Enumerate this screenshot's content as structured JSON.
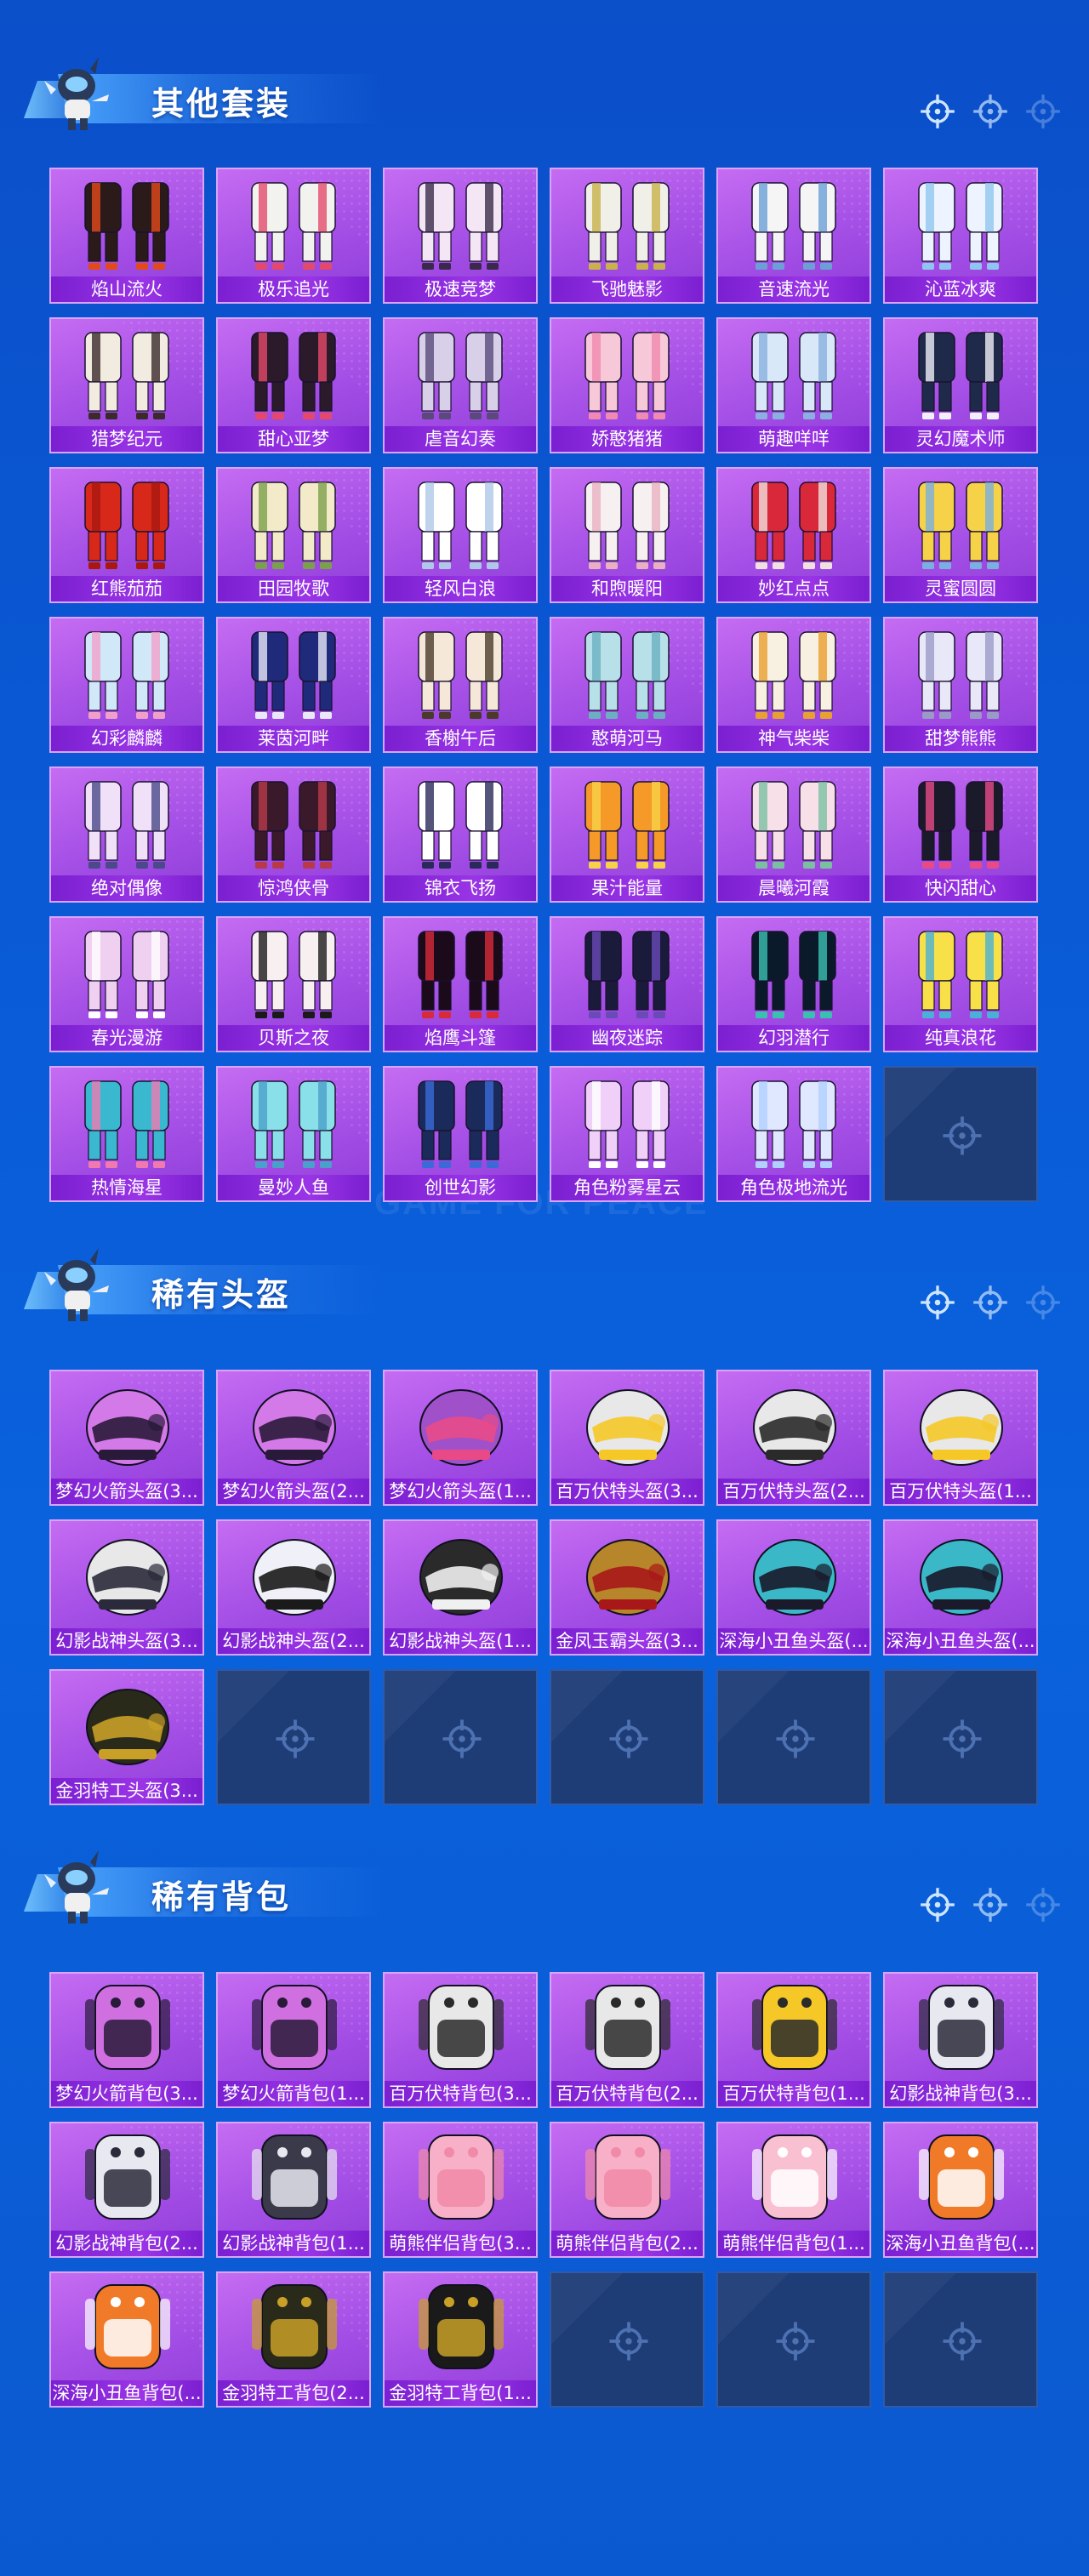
{
  "colors": {
    "background": "#0a58d4",
    "tile_purple": "#a44fe6",
    "label_bar": "#7a1fd1",
    "empty_tile": "#1e3d77"
  },
  "watermark": "GAME FOR PEACE",
  "sections": [
    {
      "title": "其他套装",
      "item_kind": "outfit",
      "items": [
        "焰山流火",
        "极乐追光",
        "极速竞梦",
        "飞驰魅影",
        "音速流光",
        "沁蓝冰爽",
        "猎梦纪元",
        "甜心亚梦",
        "虐音幻奏",
        "娇憨猪猪",
        "萌趣咩咩",
        "灵幻魔术师",
        "红熊茄茄",
        "田园牧歌",
        "轻风白浪",
        "和煦暖阳",
        "妙红点点",
        "灵蜜圆圆",
        "幻彩麟麟",
        "莱茵河畔",
        "香榭午后",
        "憨萌河马",
        "神气柴柴",
        "甜梦熊熊",
        "绝对偶像",
        "惊鸿侠骨",
        "锦衣飞扬",
        "果汁能量",
        "晨曦河霞",
        "快闪甜心",
        "春光漫游",
        "贝斯之夜",
        "焰鹰斗篷",
        "幽夜迷踪",
        "幻羽潜行",
        "纯真浪花",
        "热情海星",
        "曼妙人鱼",
        "创世幻影",
        "角色粉雾星云",
        "角色极地流光"
      ],
      "empty_slots": 1
    },
    {
      "title": "稀有头盔",
      "item_kind": "helmet",
      "items": [
        "梦幻火箭头盔(3...",
        "梦幻火箭头盔(2...",
        "梦幻火箭头盔(1...",
        "百万伏特头盔(3...",
        "百万伏特头盔(2...",
        "百万伏特头盔(1...",
        "幻影战神头盔(3...",
        "幻影战神头盔(2...",
        "幻影战神头盔(1...",
        "金凤玉霸头盔(3...",
        "深海小丑鱼头盔(...",
        "深海小丑鱼头盔(...",
        "金羽特工头盔(3..."
      ],
      "empty_slots": 5
    },
    {
      "title": "稀有背包",
      "item_kind": "backpack",
      "items": [
        "梦幻火箭背包(3...",
        "梦幻火箭背包(1...",
        "百万伏特背包(3...",
        "百万伏特背包(2...",
        "百万伏特背包(1...",
        "幻影战神背包(3...",
        "幻影战神背包(2...",
        "幻影战神背包(1...",
        "萌熊伴侣背包(3...",
        "萌熊伴侣背包(2...",
        "萌熊伴侣背包(1...",
        "深海小丑鱼背包(...",
        "深海小丑鱼背包(...",
        "金羽特工背包(2...",
        "金羽特工背包(1..."
      ],
      "empty_slots": 3
    }
  ]
}
